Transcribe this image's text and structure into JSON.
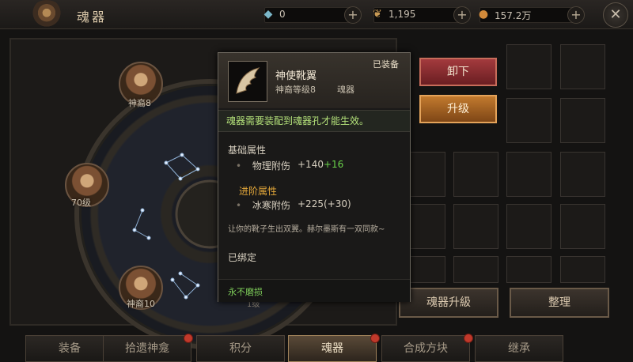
{
  "header": {
    "title": "魂器",
    "resources": [
      {
        "icon": "crystal-icon",
        "value": "0"
      },
      {
        "icon": "feather-icon",
        "value": "1,195"
      },
      {
        "icon": "coin-icon",
        "value": "157.2万"
      }
    ]
  },
  "wheel": {
    "nodes": [
      {
        "label": "神裔8"
      },
      {
        "label": "70级"
      },
      {
        "label": "神裔10"
      }
    ],
    "part_label": "1级"
  },
  "actions": {
    "unequip": "卸下",
    "upgrade": "升级",
    "soul_upgrade": "魂器升級",
    "organize": "整理"
  },
  "tabs": [
    {
      "label": "装备",
      "badge": false
    },
    {
      "label": "拾遗神龛",
      "badge": true
    },
    {
      "label": "积分",
      "badge": false
    },
    {
      "label": "魂器",
      "badge": true,
      "active": true
    },
    {
      "label": "合成方块",
      "badge": true
    },
    {
      "label": "继承",
      "badge": false
    }
  ],
  "tooltip": {
    "equipped": "已装备",
    "name": "神使靴翼",
    "level": "神裔等级8",
    "type": "魂器",
    "warning": "魂器需要装配到魂器孔才能生效。",
    "base_label": "基础属性",
    "base_stat": {
      "name": "物理附伤",
      "value": "+140",
      "bonus": "+16"
    },
    "adv_label": "进阶属性",
    "adv_stat": {
      "name": "冰寒附伤",
      "value": "+225(+30)"
    },
    "description": "让你的靴子生出双翼。赫尔墨斯有一双同款~",
    "bound": "已绑定",
    "durability": "永不磨损"
  },
  "colors": {
    "accent": "#c27a2e",
    "danger": "#a33a3d",
    "positive": "#6ad44a",
    "advanced": "#e4a83a"
  }
}
